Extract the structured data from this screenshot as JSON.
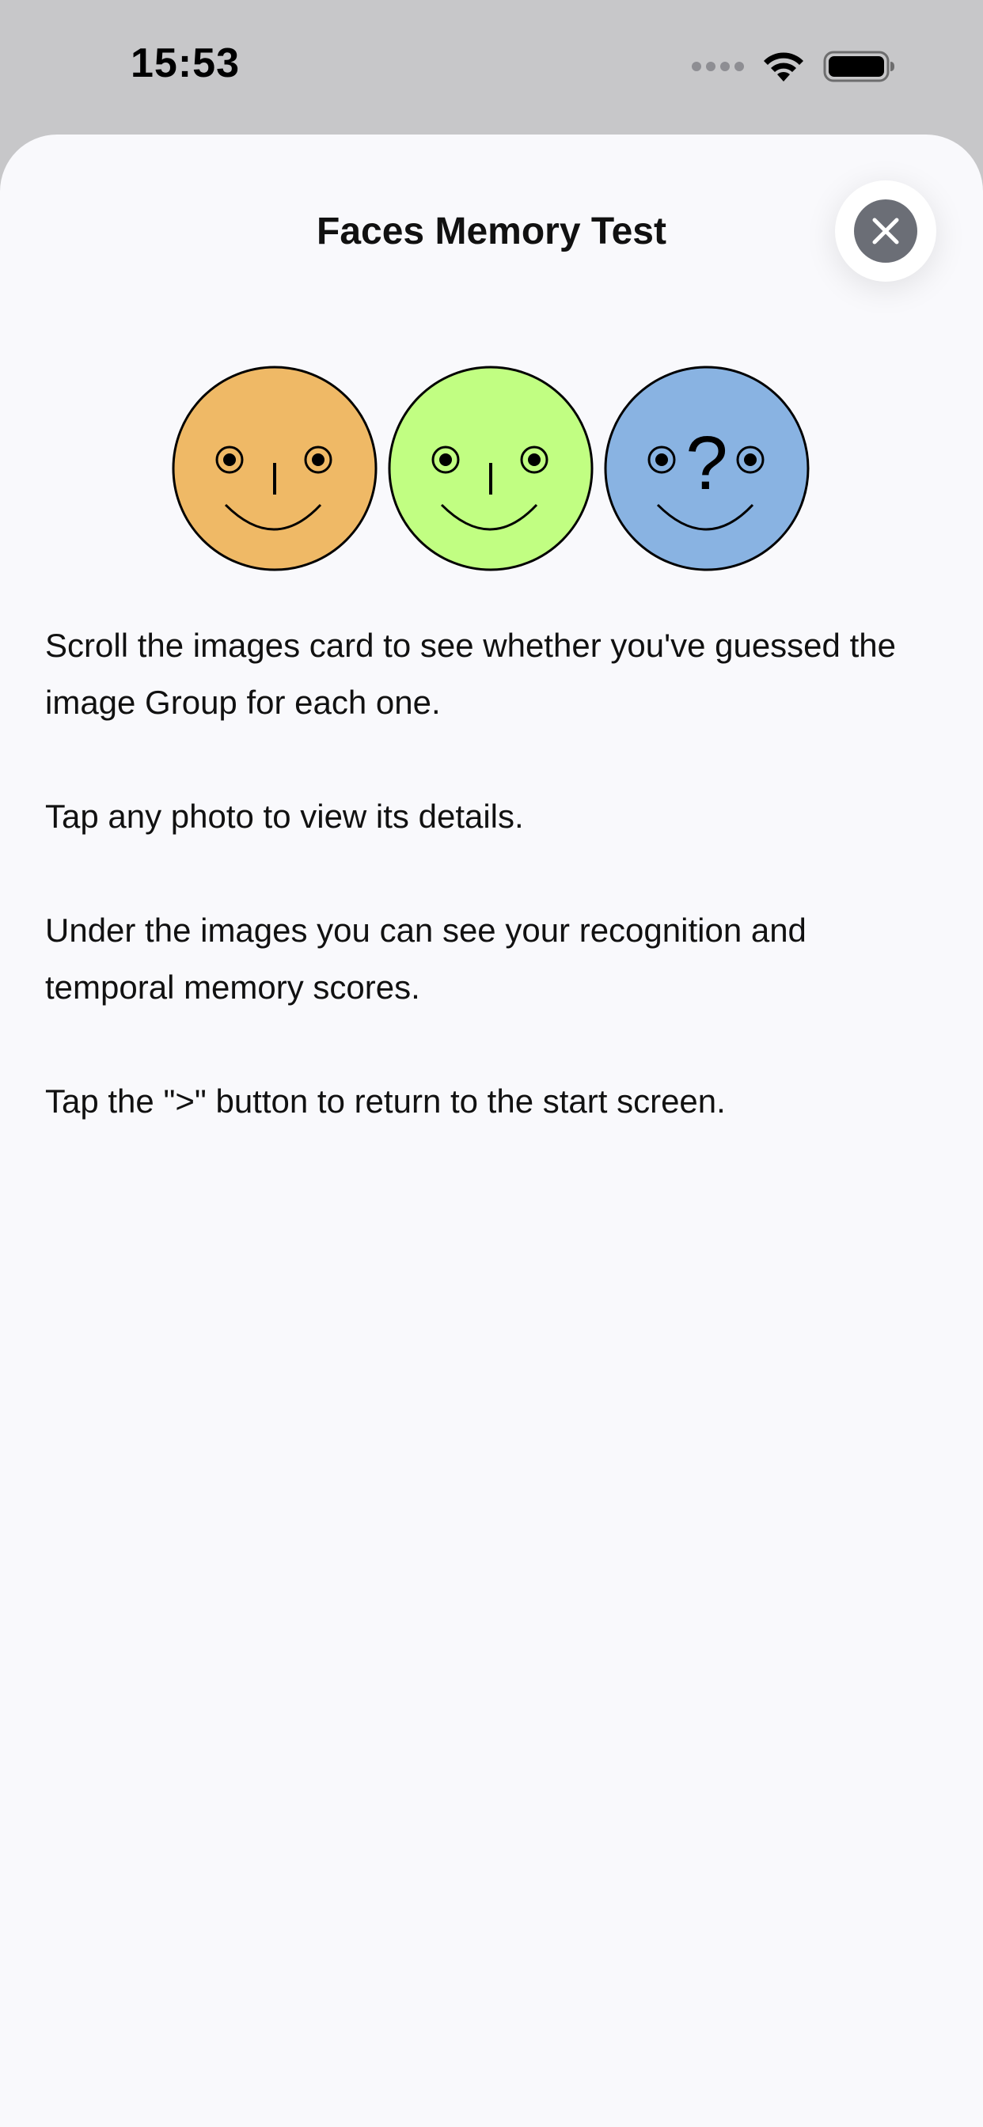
{
  "status_bar": {
    "time": "15:53",
    "icons": [
      "signal-dots-icon",
      "wifi-icon",
      "battery-icon"
    ]
  },
  "sheet": {
    "title": "Faces Memory Test",
    "close_icon": "close-icon"
  },
  "faces": [
    {
      "name": "orange-face",
      "color": "#efb966",
      "symbol": "nose"
    },
    {
      "name": "green-face",
      "color": "#c1fe82",
      "symbol": "nose"
    },
    {
      "name": "blue-face",
      "color": "#89b3e2",
      "symbol": "?"
    }
  ],
  "instructions": [
    "Scroll the images card to see whether you've guessed the image Group for each one.",
    "Tap any photo to view its details.",
    "Under the images you can see your recognition and temporal memory scores.",
    "Tap the \">\" button to return to the start screen."
  ]
}
